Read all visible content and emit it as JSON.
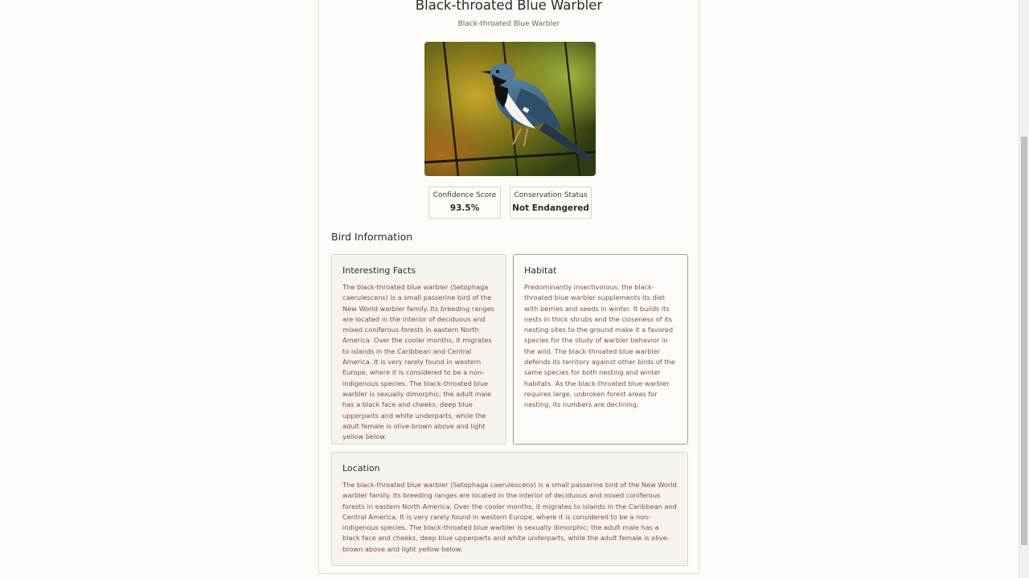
{
  "bird": {
    "name": "Black-throated Blue Warbler",
    "subtitle": "Black-throated Blue Warbler"
  },
  "stats": {
    "confidence_label": "Confidence Score",
    "confidence_value": "93.5%",
    "conservation_label": "Conservation Status",
    "conservation_value": "Not Endangered"
  },
  "info": {
    "heading": "Bird Information",
    "facts_title": "Interesting Facts",
    "facts_text": "The black-throated blue warbler (Setophaga caerulescens) is a small passerine bird of the New World warbler family. Its breeding ranges are located in the interior of deciduous and mixed coniferous forests in eastern North America. Over the cooler months, it migrates to islands in the Caribbean and Central America. It is very rarely found in western Europe, where it is considered to be a non-indigenous species. The black-throated blue warbler is sexually dimorphic; the adult male has a black face and cheeks, deep blue upperparts and white underparts, while the adult female is olive-brown above and light yellow below.",
    "habitat_title": "Habitat",
    "habitat_text": "Predominantly insectivorous, the black-throated blue warbler supplements its diet with berries and seeds in winter. It builds its nests in thick shrubs and the closeness of its nesting sites to the ground make it a favored species for the study of warbler behavior in the wild. The black-throated blue warbler defends its territory against other birds of the same species for both nesting and winter habitats. As the black-throated blue warbler requires large, unbroken forest areas for nesting, its numbers are declining.",
    "location_title": "Location",
    "location_text": "The black-throated blue warbler (Setophaga caerulescens) is a small passerine bird of the New World warbler family. Its breeding ranges are located in the interior of deciduous and mixed coniferous forests in eastern North America. Over the cooler months, it migrates to islands in the Caribbean and Central America. It is very rarely found in western Europe, where it is considered to be a non-indigenous species. The black-throated blue warbler is sexually dimorphic; the adult male has a black face and cheeks, deep blue upperparts and white underparts, while the adult female is olive-brown above and light yellow below."
  },
  "colors": {
    "background": "#fdfcf8",
    "body_text": "#8a4a2e",
    "heading_text": "#2f2a26"
  }
}
